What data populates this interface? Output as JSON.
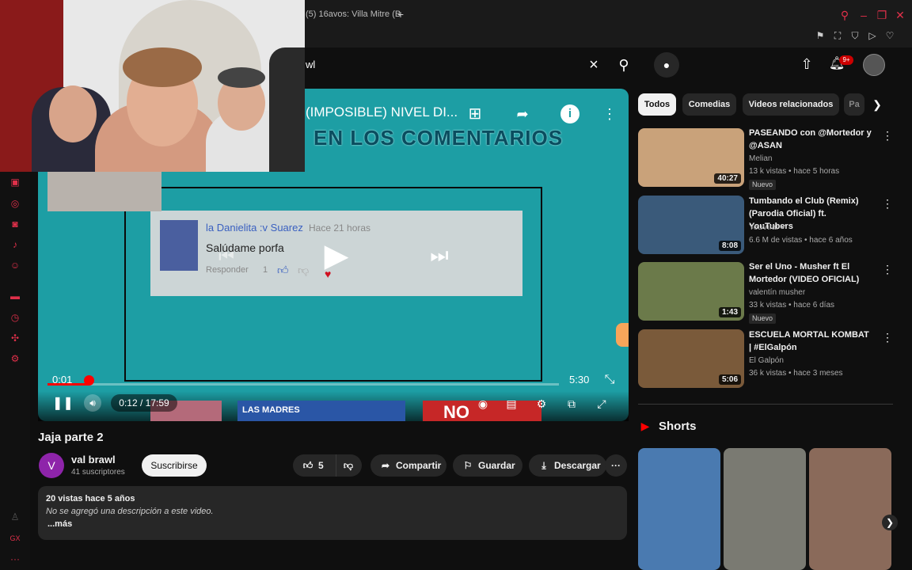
{
  "browser": {
    "tab_title": "(5) 16avos: Villa Mitre (B",
    "new_tab": "+"
  },
  "search": {
    "value": "wl"
  },
  "notifications": {
    "badge": "9+"
  },
  "player": {
    "title_fragment": "(IMPOSIBLE) NIVEL DI...",
    "caption_banner": "EN LOS COMENTARIOS",
    "comment": {
      "author": "la Danielita :v Suarez",
      "time": "Hace 21 horas",
      "text": "Salúdame porfa",
      "reply": "Responder",
      "likes": "1"
    },
    "inner_elapsed": "0:01",
    "inner_remaining": "5:30",
    "time_display": "0:12 / 17:59",
    "progress": 0.011,
    "endscreen": {
      "thumb2_text": "LAS MADRES",
      "thumb3_text": "NO"
    }
  },
  "video": {
    "title": "Jaja parte 2",
    "channel_initial": "V",
    "channel_name": "val brawl",
    "subscribers": "41 suscriptores",
    "subscribe_label": "Suscribirse",
    "likes": "5",
    "share_label": "Compartir",
    "save_label": "Guardar",
    "download_label": "Descargar",
    "description": {
      "meta": "20 vistas  hace 5 años",
      "text": "No se agregó una descripción a este video.",
      "more": "...más"
    }
  },
  "chips": [
    "Todos",
    "Comedias",
    "Videos relacionados",
    "Pa"
  ],
  "related": [
    {
      "title": "PASEANDO con @Mortedor y @ASAN",
      "channel": "Melian",
      "stats": "13 k vistas • hace 5 horas",
      "duration": "40:27",
      "badge": "Nuevo",
      "color": "#c9a27a"
    },
    {
      "title": "Tumbando el Club (Remix) (Parodia Oficial) ft. YouTubers",
      "channel": "YouViral ✔",
      "stats": "6.6 M de vistas • hace 6 años",
      "duration": "8:08",
      "badge": "",
      "color": "#3a5a7a"
    },
    {
      "title": "Ser el Uno - Musher ft El Mortedor (VIDEO OFICIAL)",
      "channel": "valentín musher",
      "stats": "33 k vistas • hace 6 días",
      "duration": "1:43",
      "badge": "Nuevo",
      "color": "#6b7a4a"
    },
    {
      "title": "ESCUELA MORTAL KOMBAT | #ElGalpón",
      "channel": "El Galpón",
      "stats": "36 k vistas • hace 3 meses",
      "duration": "5:06",
      "badge": "",
      "color": "#7a5a3a"
    }
  ],
  "shorts": {
    "title": "Shorts"
  },
  "colors": {
    "accent": "#ff0000",
    "background": "#0f0f0f",
    "player_bg": "#1d9ea4"
  }
}
